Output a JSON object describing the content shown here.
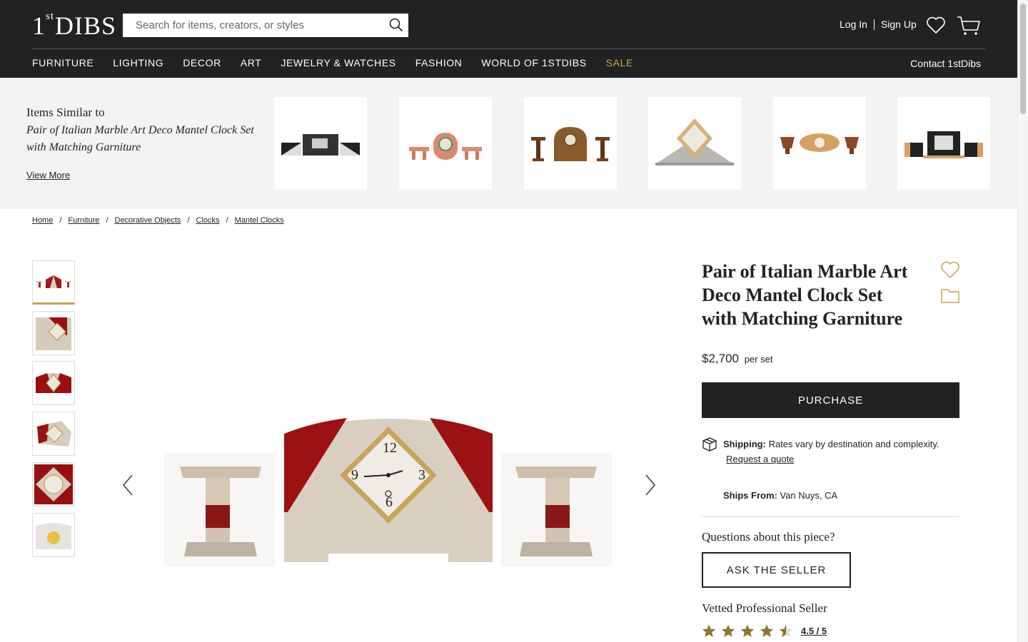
{
  "header": {
    "logo_prefix": "1",
    "logo_super": "st",
    "logo_main": "DIBS",
    "search_placeholder": "Search for items, creators, or styles",
    "login": "Log In",
    "signup": "Sign Up",
    "nav": [
      "FURNITURE",
      "LIGHTING",
      "DECOR",
      "ART",
      "JEWELRY & WATCHES",
      "FASHION",
      "WORLD OF 1STDIBS",
      "SALE"
    ],
    "contact": "Contact 1stDibs",
    "accent_color": "#c8a35a"
  },
  "similar": {
    "heading": "Items Similar to",
    "title": "Pair of Italian Marble Art Deco Mantel Clock Set with Matching Garniture",
    "view_more": "View More"
  },
  "breadcrumb": [
    "Home",
    "Furniture",
    "Decorative Objects",
    "Clocks",
    "Mantel Clocks"
  ],
  "product": {
    "title": "Pair of Italian Marble Art Deco Mantel Clock Set with Matching Garniture",
    "price": "$2,700",
    "price_unit": "per set",
    "purchase": "PURCHASE",
    "shipping_label": "Shipping:",
    "shipping_text": "Rates vary by destination and complexity.",
    "request_quote": "Request a quote",
    "ships_from_label": "Ships From:",
    "ships_from": "Van Nuys, CA",
    "questions": "Questions about this piece?",
    "ask_seller": "ASK THE SELLER",
    "seller_label": "Vetted Professional Seller",
    "rating": "4.5 / 5",
    "rating_value": 4.5,
    "rating_max": 5
  },
  "icons": {
    "search": "search-icon",
    "favorite": "heart-icon",
    "cart": "cart-icon",
    "folder": "folder-icon",
    "shipping": "package-icon",
    "prev": "chevron-left-icon",
    "next": "chevron-right-icon",
    "star": "star-icon"
  }
}
